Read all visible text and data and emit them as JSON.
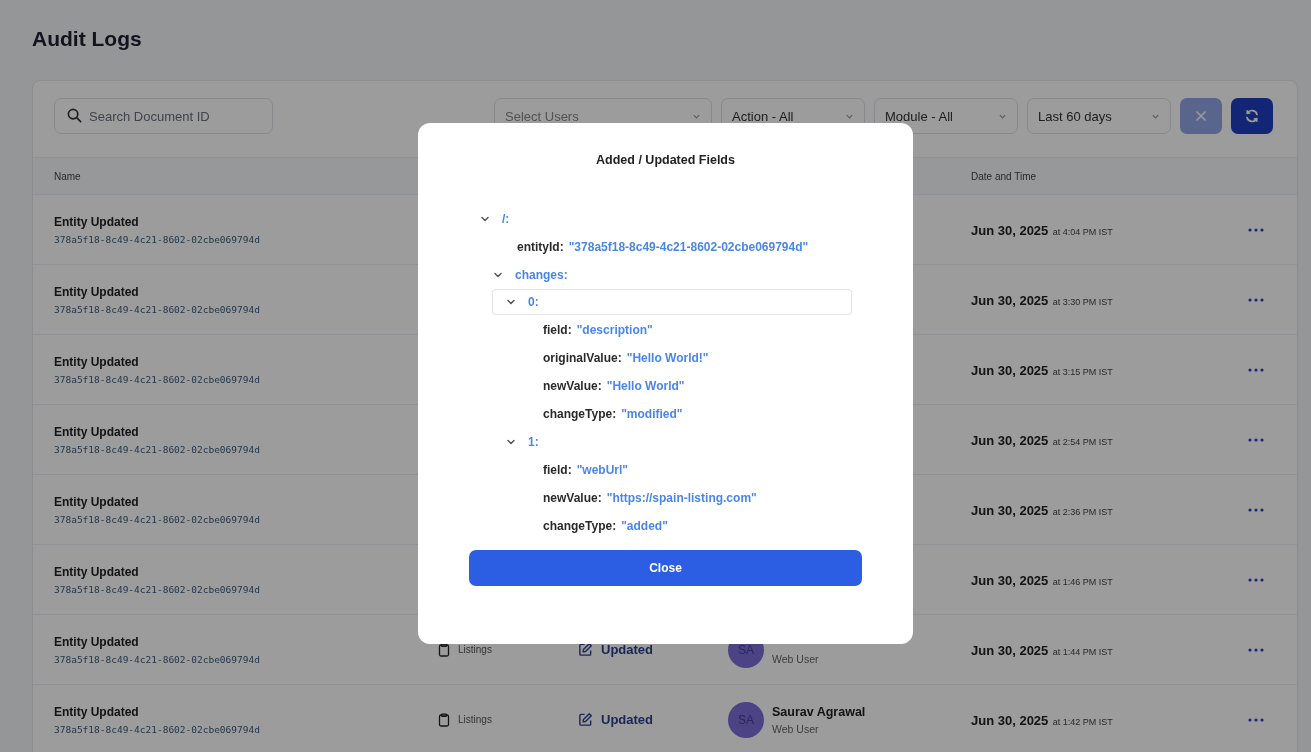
{
  "page": {
    "title": "Audit Logs"
  },
  "filters": {
    "search": {
      "placeholder": "Search Document ID"
    },
    "dropdowns": [
      {
        "placeholder": "Select Users"
      },
      {
        "value": "Action - All"
      },
      {
        "value": "Module - All"
      },
      {
        "value": "Last 60 days"
      }
    ],
    "clear_button": {
      "disabled": true
    },
    "refresh_button": {
      "disabled": false
    }
  },
  "table": {
    "name_header": "Name",
    "date_header": "Date and Time",
    "rows": [
      {
        "name": "Entity Updated",
        "id": "378a5f18-8c49-4c21-8602-02cbe069794d",
        "date": "Jun 30, 2025",
        "time": "at 4:04 PM IST"
      },
      {
        "name": "Entity Updated",
        "id": "378a5f18-8c49-4c21-8602-02cbe069794d",
        "date": "Jun 30, 2025",
        "time": "at 3:30 PM IST"
      },
      {
        "name": "Entity Updated",
        "id": "378a5f18-8c49-4c21-8602-02cbe069794d",
        "date": "Jun 30, 2025",
        "time": "at 3:15 PM IST"
      },
      {
        "name": "Entity Updated",
        "id": "378a5f18-8c49-4c21-8602-02cbe069794d",
        "date": "Jun 30, 2025",
        "time": "at 2:54 PM IST"
      },
      {
        "name": "Entity Updated",
        "id": "378a5f18-8c49-4c21-8602-02cbe069794d",
        "date": "Jun 30, 2025",
        "time": "at 2:36 PM IST"
      },
      {
        "name": "Entity Updated",
        "id": "378a5f18-8c49-4c21-8602-02cbe069794d",
        "date": "Jun 30, 2025",
        "time": "at 1:46 PM IST"
      },
      {
        "name": "Entity Updated",
        "id": "378a5f18-8c49-4c21-8602-02cbe069794d",
        "module": "Listings",
        "action": "Updated",
        "user": {
          "initials": "SA",
          "role": "Web User"
        },
        "date": "Jun 30, 2025",
        "time": "at 1:44 PM IST"
      },
      {
        "name": "Entity Updated",
        "id": "378a5f18-8c49-4c21-8602-02cbe069794d",
        "module": "Listings",
        "action": "Updated",
        "user": {
          "initials": "SA",
          "name": "Saurav Agrawal",
          "role": "Web User"
        },
        "date": "Jun 30, 2025",
        "time": "at 1:42 PM IST"
      }
    ]
  },
  "modal": {
    "title": "Added / Updated Fields",
    "tree": [
      {
        "kind": "branch",
        "key": "/:",
        "expanded": true,
        "selected": false,
        "children": [
          {
            "kind": "leaf",
            "key": "entityId:",
            "value": "\"378a5f18-8c49-4c21-8602-02cbe069794d\""
          },
          {
            "kind": "branch",
            "key": "changes:",
            "expanded": true,
            "selected": false,
            "children": [
              {
                "kind": "branch",
                "key": "0:",
                "expanded": true,
                "selected": true,
                "children": [
                  {
                    "kind": "leaf",
                    "key": "field:",
                    "value": "\"description\""
                  },
                  {
                    "kind": "leaf",
                    "key": "originalValue:",
                    "value": "\"Hello World!\""
                  },
                  {
                    "kind": "leaf",
                    "key": "newValue:",
                    "value": "\"Hello World\""
                  },
                  {
                    "kind": "leaf",
                    "key": "changeType:",
                    "value": "\"modified\""
                  }
                ]
              },
              {
                "kind": "branch",
                "key": "1:",
                "expanded": true,
                "selected": false,
                "children": [
                  {
                    "kind": "leaf",
                    "key": "field:",
                    "value": "\"webUrl\""
                  },
                  {
                    "kind": "leaf",
                    "key": "newValue:",
                    "value": "\"https://spain-listing.com\""
                  },
                  {
                    "kind": "leaf",
                    "key": "changeType:",
                    "value": "\"added\""
                  }
                ]
              }
            ]
          }
        ]
      }
    ],
    "close_button": "Close"
  }
}
